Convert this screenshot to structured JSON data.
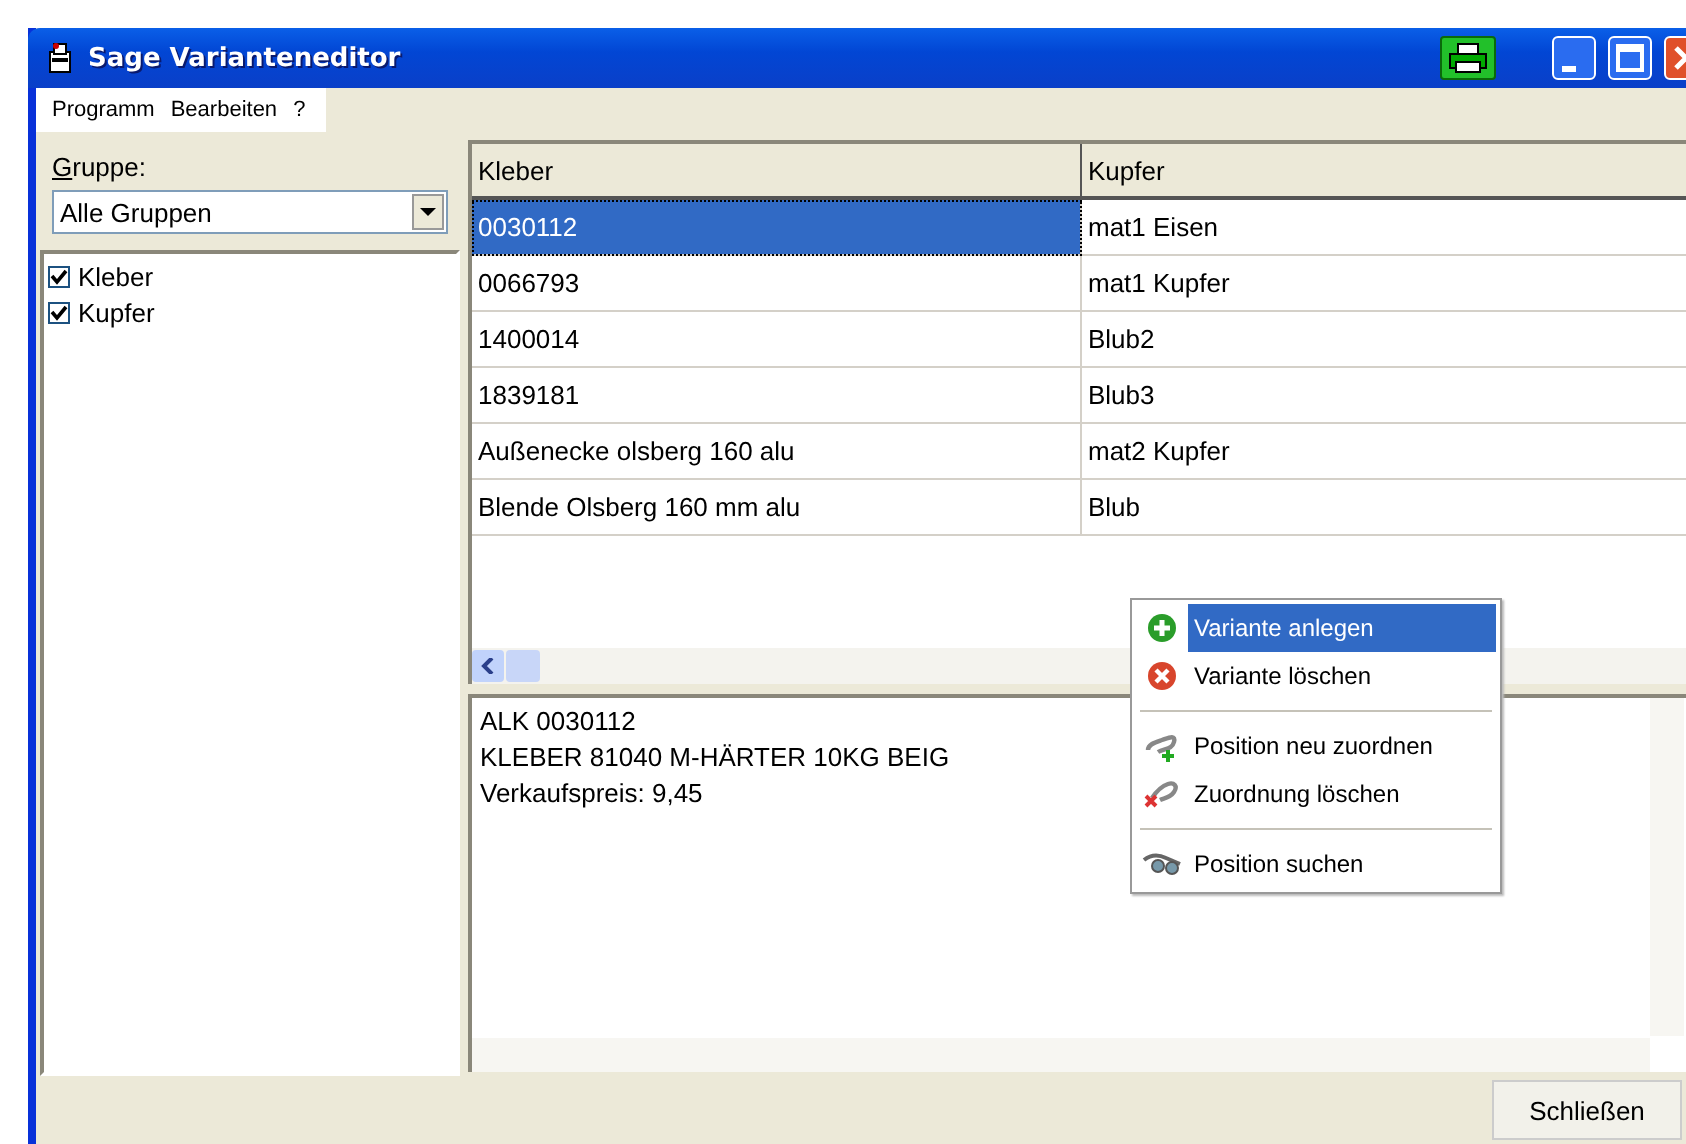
{
  "window": {
    "title": "Sage Varianteneditor"
  },
  "menu_bar": [
    "Programm",
    "Bearbeiten",
    "?"
  ],
  "sidebar": {
    "group_label": "Gruppe:",
    "group_select": {
      "value": "Alle Gruppen"
    },
    "groups": [
      {
        "label": "Kleber",
        "checked": true
      },
      {
        "label": "Kupfer",
        "checked": true
      }
    ]
  },
  "table": {
    "columns": [
      "Kleber",
      "Kupfer"
    ],
    "rows": [
      {
        "cells": [
          "0030112",
          "mat1 Eisen"
        ],
        "selected": true
      },
      {
        "cells": [
          "0066793",
          "mat1 Kupfer"
        ],
        "selected": false
      },
      {
        "cells": [
          "1400014",
          "Blub2"
        ],
        "selected": false
      },
      {
        "cells": [
          "1839181",
          "Blub3"
        ],
        "selected": false
      },
      {
        "cells": [
          "Außenecke olsberg 160 alu",
          "mat2 Kupfer"
        ],
        "selected": false
      },
      {
        "cells": [
          "Blende Olsberg 160 mm alu",
          "Blub"
        ],
        "selected": false
      }
    ]
  },
  "details": [
    "ALK 0030112",
    "KLEBER 81040 M-HÄRTER 10KG BEIG",
    "Verkaufspreis: 9,45"
  ],
  "context_menu": {
    "groups": [
      [
        {
          "label": "Variante anlegen",
          "selected": true
        },
        {
          "label": "Variante löschen",
          "selected": false
        }
      ],
      [
        {
          "label": "Position neu zuordnen",
          "selected": false
        },
        {
          "label": "Zuordnung löschen",
          "selected": false
        }
      ],
      [
        {
          "label": "Position suchen",
          "selected": false
        }
      ]
    ]
  },
  "buttons": [
    "Schließen"
  ]
}
